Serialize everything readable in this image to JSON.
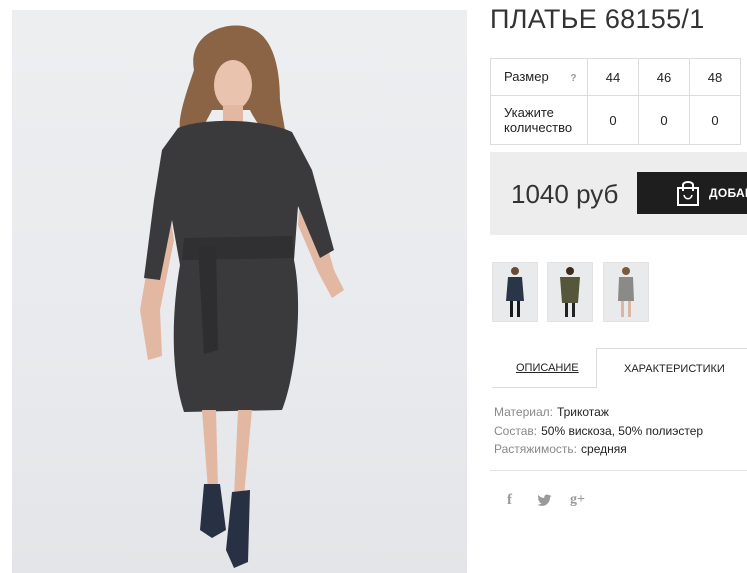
{
  "product": {
    "title": "ПЛАТЬЕ 68155/1"
  },
  "size_table": {
    "size_label": "Размер",
    "help_icon": "?",
    "sizes": [
      "44",
      "46",
      "48"
    ],
    "quantity_label": "Укажите количество",
    "quantities": [
      "0",
      "0",
      "0"
    ]
  },
  "purchase": {
    "price": "1040 руб",
    "add_to_cart_label": "ДОБАВ",
    "cart_icon": "shopping-bag-icon"
  },
  "tabs": {
    "description": "ОПИСАНИЕ",
    "specs": "ХАРАКТЕРИСТИКИ",
    "active": "specs"
  },
  "specs": [
    {
      "key": "Материал:",
      "value": "Трикотаж"
    },
    {
      "key": "Состав:",
      "value": "50% вискоза, 50% полиэстер"
    },
    {
      "key": "Растяжимость:",
      "value": "средняя"
    }
  ],
  "social": {
    "facebook": "f",
    "twitter": "🐦",
    "googleplus": "g+"
  },
  "colors": {
    "cart_button": "#1e1e1e",
    "price_box": "#ededed",
    "dress": "#3a3a3c",
    "thumb_dress_1": "#2b3548",
    "thumb_dress_2": "#56563a",
    "thumb_dress_3": "#8a8a88"
  }
}
